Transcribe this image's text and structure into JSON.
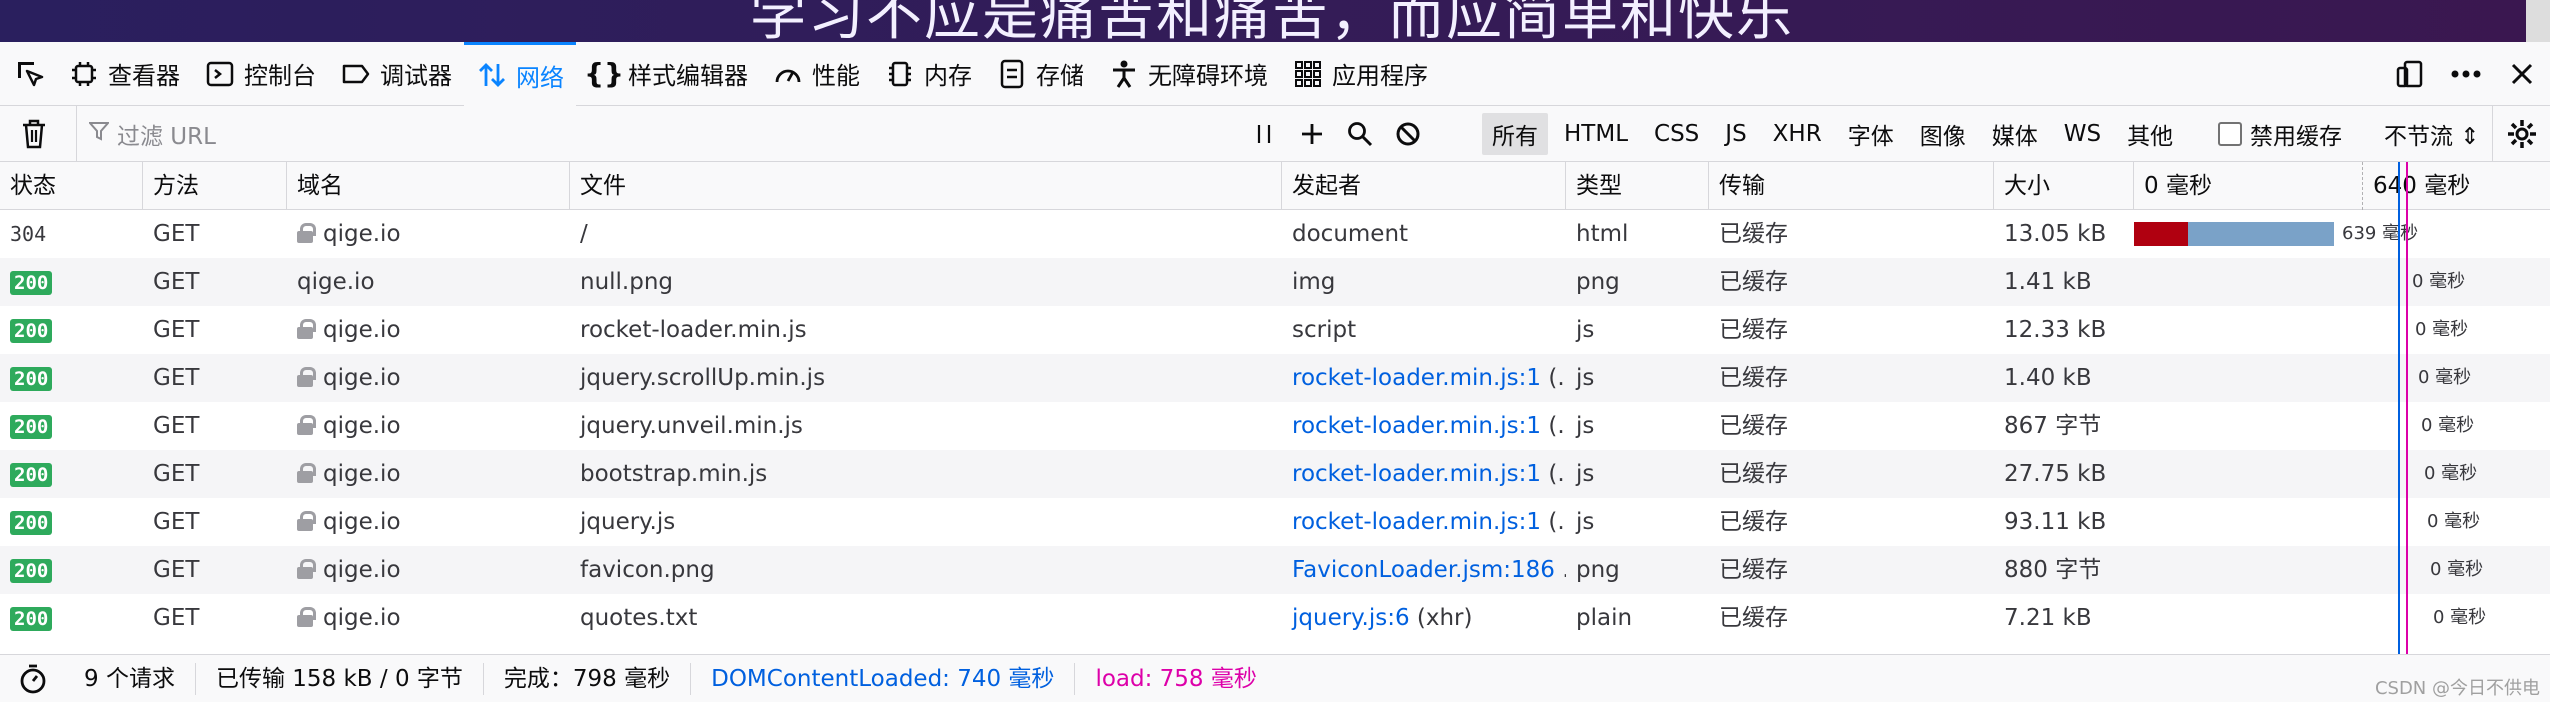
{
  "banner": {
    "text": "学习不应是痛苦和痛苦，而应简单和快乐"
  },
  "tabs": [
    {
      "id": "picker",
      "label": "",
      "icon": "element-picker-icon"
    },
    {
      "id": "inspector",
      "label": "查看器",
      "icon": "inspector-icon"
    },
    {
      "id": "console",
      "label": "控制台",
      "icon": "console-icon"
    },
    {
      "id": "debugger",
      "label": "调试器",
      "icon": "debugger-icon"
    },
    {
      "id": "network",
      "label": "网络",
      "icon": "network-icon",
      "selected": true
    },
    {
      "id": "style-editor",
      "label": "样式编辑器",
      "icon": "braces-icon"
    },
    {
      "id": "performance",
      "label": "性能",
      "icon": "gauge-icon"
    },
    {
      "id": "memory",
      "label": "内存",
      "icon": "memory-icon"
    },
    {
      "id": "storage",
      "label": "存储",
      "icon": "storage-icon"
    },
    {
      "id": "accessibility",
      "label": "无障碍环境",
      "icon": "accessibility-icon"
    },
    {
      "id": "application",
      "label": "应用程序",
      "icon": "grid-icon"
    }
  ],
  "toolbar": {
    "filter_placeholder": "过滤 URL",
    "type_filters": [
      "所有",
      "HTML",
      "CSS",
      "JS",
      "XHR",
      "字体",
      "图像",
      "媒体",
      "WS",
      "其他"
    ],
    "active_filter": "所有",
    "disable_cache_label": "禁用缓存",
    "throttle_label": "不节流 ⇕"
  },
  "columns": {
    "status": "状态",
    "method": "方法",
    "domain": "域名",
    "file": "文件",
    "initiator": "发起者",
    "type": "类型",
    "transferred": "传输",
    "size": "大小",
    "waterfall_start": "0 毫秒",
    "waterfall_end": "640 毫秒"
  },
  "rows": [
    {
      "status": "304",
      "badge": false,
      "method": "GET",
      "secure": true,
      "domain": "qige.io",
      "file": "/",
      "initiator": "document",
      "initiator_link": false,
      "initiator_suffix": "",
      "type": "html",
      "transferred": "已缓存",
      "size": "13.05 kB",
      "timing": "639 毫秒",
      "wf_red": 0.13,
      "wf_blue": 0.35
    },
    {
      "status": "200",
      "badge": true,
      "method": "GET",
      "secure": false,
      "domain": "qige.io",
      "file": "null.png",
      "initiator": "img",
      "initiator_link": false,
      "initiator_suffix": "",
      "type": "png",
      "transferred": "已缓存",
      "size": "1.41 kB",
      "timing": "0 毫秒"
    },
    {
      "status": "200",
      "badge": true,
      "method": "GET",
      "secure": true,
      "domain": "qige.io",
      "file": "rocket-loader.min.js",
      "initiator": "script",
      "initiator_link": false,
      "initiator_suffix": "",
      "type": "js",
      "transferred": "已缓存",
      "size": "12.33 kB",
      "timing": "0 毫秒"
    },
    {
      "status": "200",
      "badge": true,
      "method": "GET",
      "secure": true,
      "domain": "qige.io",
      "file": "jquery.scrollUp.min.js",
      "initiator": "rocket-loader.min.js:1",
      "initiator_link": true,
      "initiator_suffix": " (...",
      "type": "js",
      "transferred": "已缓存",
      "size": "1.40 kB",
      "timing": "0 毫秒"
    },
    {
      "status": "200",
      "badge": true,
      "method": "GET",
      "secure": true,
      "domain": "qige.io",
      "file": "jquery.unveil.min.js",
      "initiator": "rocket-loader.min.js:1",
      "initiator_link": true,
      "initiator_suffix": " (...",
      "type": "js",
      "transferred": "已缓存",
      "size": "867 字节",
      "timing": "0 毫秒"
    },
    {
      "status": "200",
      "badge": true,
      "method": "GET",
      "secure": true,
      "domain": "qige.io",
      "file": "bootstrap.min.js",
      "initiator": "rocket-loader.min.js:1",
      "initiator_link": true,
      "initiator_suffix": " (...",
      "type": "js",
      "transferred": "已缓存",
      "size": "27.75 kB",
      "timing": "0 毫秒"
    },
    {
      "status": "200",
      "badge": true,
      "method": "GET",
      "secure": true,
      "domain": "qige.io",
      "file": "jquery.js",
      "initiator": "rocket-loader.min.js:1",
      "initiator_link": true,
      "initiator_suffix": " (...",
      "type": "js",
      "transferred": "已缓存",
      "size": "93.11 kB",
      "timing": "0 毫秒"
    },
    {
      "status": "200",
      "badge": true,
      "method": "GET",
      "secure": true,
      "domain": "qige.io",
      "file": "favicon.png",
      "initiator": "FaviconLoader.jsm:186",
      "initiator_link": true,
      "initiator_suffix": " ...",
      "type": "png",
      "transferred": "已缓存",
      "size": "880 字节",
      "timing": "0 毫秒"
    },
    {
      "status": "200",
      "badge": true,
      "method": "GET",
      "secure": true,
      "domain": "qige.io",
      "file": "quotes.txt",
      "initiator": "jquery.js:6",
      "initiator_link": true,
      "initiator_suffix": " (xhr)",
      "type": "plain",
      "transferred": "已缓存",
      "size": "7.21 kB",
      "timing": "0 毫秒"
    }
  ],
  "footer": {
    "requests": "9 个请求",
    "transferred": "已传输 158 kB / 0 字节",
    "finish": "完成：798 毫秒",
    "dom_content_loaded": "DOMContentLoaded: 740 毫秒",
    "load": "load: 758 毫秒"
  },
  "watermark": "CSDN @今日不供电",
  "colors": {
    "accent": "#0a84ff",
    "badge": "#2eaa5c",
    "dcl": "#0060df",
    "load": "#dd00a9",
    "wf_red": "#b00010",
    "wf_blue": "#7aa2c8"
  }
}
